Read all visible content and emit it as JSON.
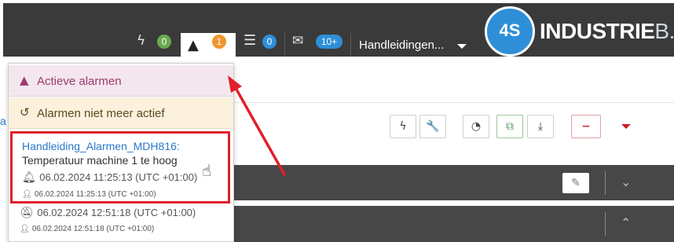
{
  "topbar": {
    "flash_count": "0",
    "alarm_count": "1",
    "list_count": "0",
    "mail_count": "10+",
    "organization": "Handleidingen...",
    "logo_mark": "4S",
    "logo_name": "INDUSTRIE",
    "logo_suffix": "B.V."
  },
  "dropdown": {
    "active_label": "Actieve alarmen",
    "inactive_label": "Alarmen niet meer actief",
    "entries": [
      {
        "name": "Handleiding_Alarmen_MDH816:",
        "description": "Temperatuur machine 1 te hoog",
        "time": "06.02.2024 11:25:13 (UTC +01:00)",
        "user_time": "06.02.2024 11:25:13 (UTC +01:00)"
      },
      {
        "time": "06.02.2024 12:51:18 (UTC +01:00)",
        "user_time": "06.02.2024 12:51:18 (UTC +01:00)"
      }
    ]
  },
  "page_edge_text": "a",
  "colors": {
    "topbar_bg": "#3a3a3a",
    "green_badge": "#6aa84f",
    "orange_badge": "#f0962d",
    "blue_badge": "#2e8fd8",
    "highlight": "#e0202a"
  }
}
